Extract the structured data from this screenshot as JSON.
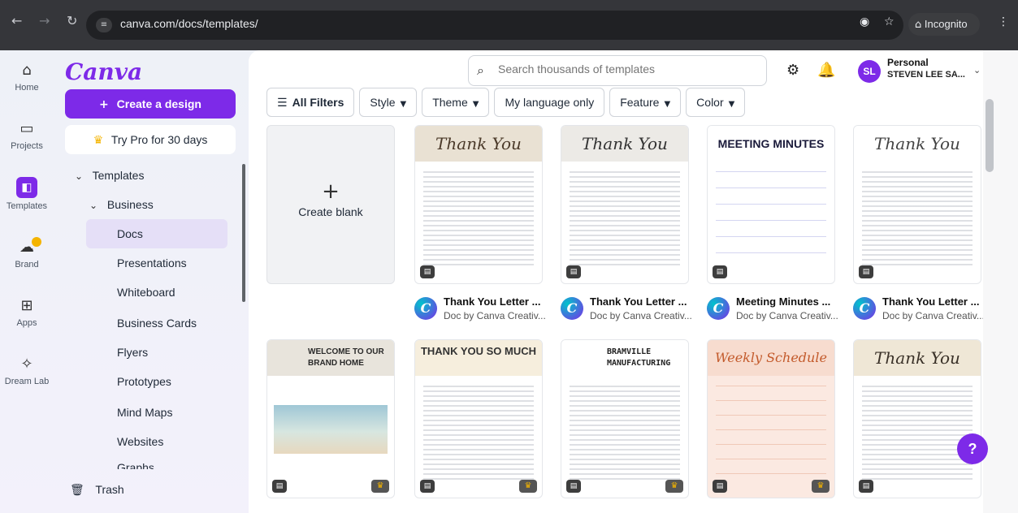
{
  "browser": {
    "url": "canva.com/docs/templates/",
    "incognito_label": "Incognito",
    "icons": [
      "back-arrow-icon",
      "forward-arrow-icon",
      "reload-icon",
      "site-info-icon",
      "eye-off-icon",
      "star-icon",
      "incognito-icon",
      "menu-dots-icon"
    ]
  },
  "rail": {
    "items": [
      {
        "label": "Home",
        "icon": "home-icon"
      },
      {
        "label": "Projects",
        "icon": "folder-icon"
      },
      {
        "label": "Templates",
        "icon": "templates-icon"
      },
      {
        "label": "Brand",
        "icon": "brand-icon"
      },
      {
        "label": "Apps",
        "icon": "apps-icon"
      },
      {
        "label": "Dream Lab",
        "icon": "dream-lab-icon"
      }
    ]
  },
  "panel": {
    "logo": "Canva",
    "create_label": "Create a design",
    "pro_label": "Try Pro for 30 days",
    "tree": {
      "templates": "Templates",
      "business": "Business",
      "items": [
        "Docs",
        "Presentations",
        "Whiteboard",
        "Business Cards",
        "Flyers",
        "Prototypes",
        "Mind Maps",
        "Websites",
        "Graphs"
      ]
    },
    "trash_label": "Trash"
  },
  "header": {
    "search_placeholder": "Search thousands of templates",
    "account_name": "Personal",
    "account_user": "STEVEN LEE SA...",
    "avatar_initials": "SL"
  },
  "filters": [
    "All Filters",
    "Style",
    "Theme",
    "My language only",
    "Feature",
    "Color"
  ],
  "blank_label": "Create blank",
  "row1": [
    {
      "title": "Thank You Letter ...",
      "sub": "Doc by Canva Creativ...",
      "header": "Thank You"
    },
    {
      "title": "Thank You Letter ...",
      "sub": "Doc by Canva Creativ...",
      "header": "Thank You"
    },
    {
      "title": "Meeting Minutes ...",
      "sub": "Doc by Canva Creativ...",
      "header": "MEETING MINUTES"
    },
    {
      "title": "Thank You Letter ...",
      "sub": "Doc by Canva Creativ...",
      "header": "Thank You"
    }
  ],
  "row2": [
    {
      "header": "WELCOME TO OUR BRAND HOME"
    },
    {
      "header": "THANK YOU SO MUCH"
    },
    {
      "header": "BRAMVILLE MANUFACTURING"
    },
    {
      "header": "Weekly Schedule"
    },
    {
      "header": "Thank You"
    }
  ],
  "help_label": "?"
}
